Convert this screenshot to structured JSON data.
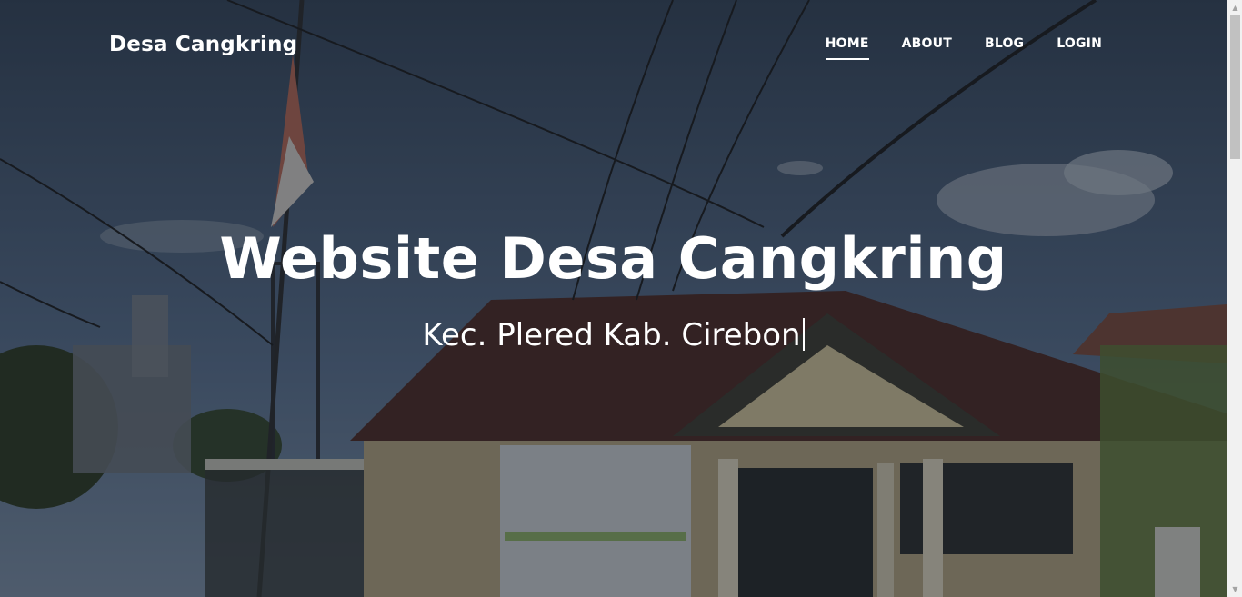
{
  "navbar": {
    "brand": "Desa Cangkring",
    "links": [
      {
        "label": "HOME",
        "active": true
      },
      {
        "label": "ABOUT",
        "active": false
      },
      {
        "label": "BLOG",
        "active": false
      },
      {
        "label": "LOGIN",
        "active": false
      }
    ]
  },
  "hero": {
    "title": "Website Desa Cangkring",
    "subtitle": "Kec. Plered Kab. Cirebon",
    "background": "village office building with flag and power lines under cloudy sky"
  },
  "colors": {
    "text": "#ffffff",
    "overlay": "#14182073",
    "sky": "#5a7394",
    "roof": "#5b2f2a",
    "wall": "#d9c9a0"
  },
  "icons": {
    "scroll_up": "chevron-up-icon",
    "scroll_down": "chevron-down-icon"
  }
}
